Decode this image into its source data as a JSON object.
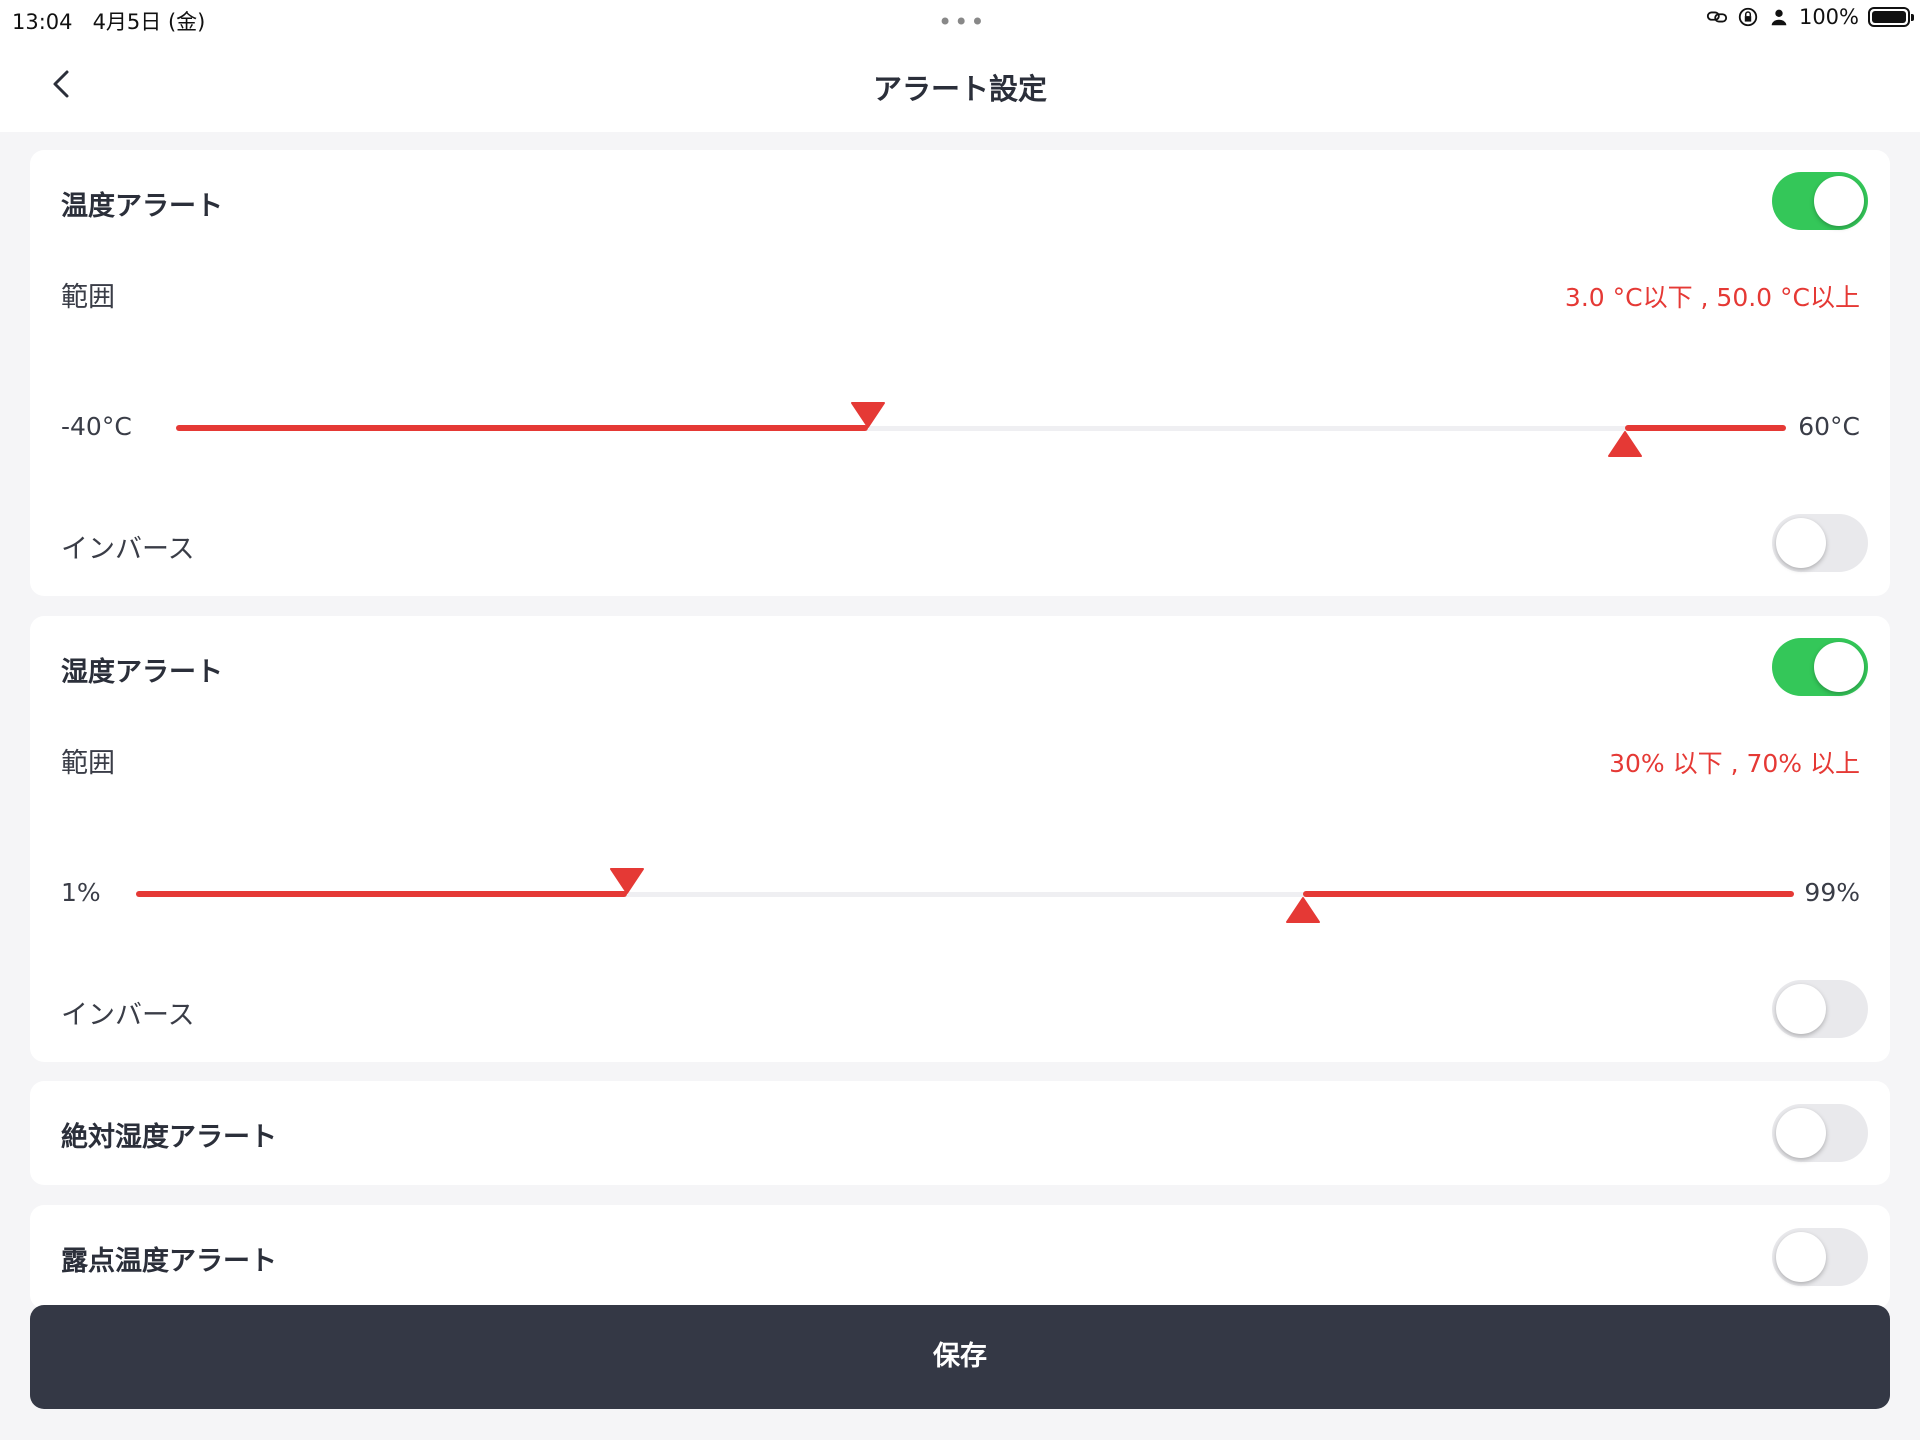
{
  "status_bar": {
    "time": "13:04",
    "date": "4月5日 (金)",
    "battery_pct": "100%",
    "icons": [
      "link-icon",
      "rotation-lock-icon",
      "person-icon",
      "battery-icon"
    ]
  },
  "nav": {
    "title": "アラート設定",
    "back_icon": "chevron-left-icon"
  },
  "temperature": {
    "title": "温度アラート",
    "enabled": true,
    "range_label": "範囲",
    "range_text": "3.0 °C以下 , 50.0 °C以上",
    "min_label": "-40°C",
    "max_label": "60°C",
    "scale_min": -40,
    "scale_max": 60,
    "low_value": 3.0,
    "high_value": 50.0,
    "inverse_label": "インバース",
    "inverse": false
  },
  "humidity": {
    "title": "湿度アラート",
    "enabled": true,
    "range_label": "範囲",
    "range_text": "30% 以下 , 70% 以上",
    "min_label": "1%",
    "max_label": "99%",
    "scale_min": 1,
    "scale_max": 99,
    "low_value": 30,
    "high_value": 70,
    "inverse_label": "インバース",
    "inverse": false
  },
  "absolute_humidity": {
    "title": "絶対湿度アラート",
    "enabled": false
  },
  "dew_point": {
    "title": "露点温度アラート",
    "enabled": false
  },
  "save_label": "保存",
  "colors": {
    "accent_red": "#e53935",
    "toggle_on": "#34c759",
    "toggle_off": "#e9e9ec",
    "save_bg": "#343845"
  }
}
